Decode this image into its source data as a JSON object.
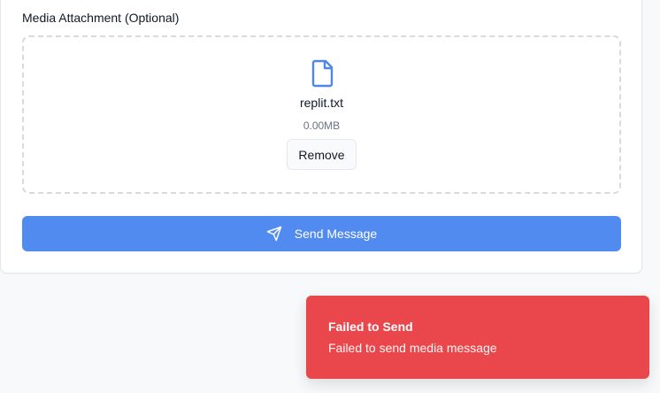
{
  "form": {
    "media_label": "Media Attachment (Optional)",
    "file": {
      "icon": "file-icon",
      "name": "replit.txt",
      "size": "0.00MB",
      "remove_label": "Remove"
    },
    "send_label": "Send Message",
    "send_icon": "send-icon"
  },
  "toast": {
    "title": "Failed to Send",
    "description": "Failed to send media message",
    "color": "#e9474b"
  },
  "colors": {
    "accent": "#528bef",
    "file_icon": "#4f86e8"
  }
}
